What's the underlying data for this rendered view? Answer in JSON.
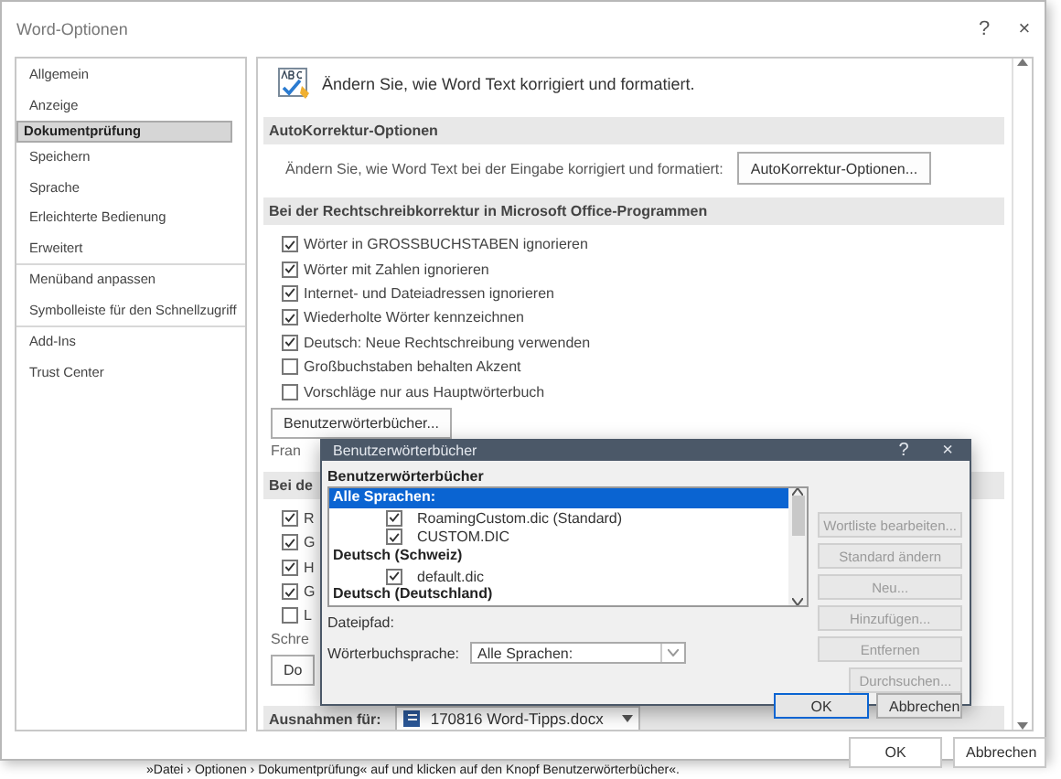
{
  "window": {
    "title": "Word-Optionen",
    "help": "?",
    "close": "×"
  },
  "sidebar": {
    "groups": [
      {
        "items": [
          {
            "label": "Allgemein",
            "selected": false
          },
          {
            "label": "Anzeige",
            "selected": false
          },
          {
            "label": "Dokumentprüfung",
            "selected": true
          },
          {
            "label": "Speichern",
            "selected": false
          },
          {
            "label": "Sprache",
            "selected": false
          },
          {
            "label": "Erleichterte Bedienung",
            "selected": false
          },
          {
            "label": "Erweitert",
            "selected": false
          }
        ]
      },
      {
        "items": [
          {
            "label": "Menüband anpassen",
            "selected": false
          },
          {
            "label": "Symbolleiste für den Schnellzugriff",
            "selected": false
          }
        ]
      },
      {
        "items": [
          {
            "label": "Add-Ins",
            "selected": false
          },
          {
            "label": "Trust Center",
            "selected": false
          }
        ]
      }
    ]
  },
  "content": {
    "intro": "Ändern Sie, wie Word Text korrigiert und formatiert.",
    "sections": [
      {
        "heading": "AutoKorrektur-Optionen",
        "items": [
          {
            "kind": "text_button",
            "text": "Ändern Sie, wie Word Text bei der Eingabe korrigiert und formatiert:",
            "button": "AutoKorrektur-Optionen..."
          }
        ]
      },
      {
        "heading": "Bei der Rechtschreibkorrektur in Microsoft Office-Programmen",
        "items": [
          {
            "kind": "checkbox",
            "label": "Wörter in GROSSBUCHSTABEN ignorieren",
            "checked": true
          },
          {
            "kind": "checkbox",
            "label": "Wörter mit Zahlen ignorieren",
            "checked": true
          },
          {
            "kind": "checkbox",
            "label": "Internet- und Dateiadressen ignorieren",
            "checked": true
          },
          {
            "kind": "checkbox",
            "label": "Wiederholte Wörter kennzeichnen",
            "checked": true
          },
          {
            "kind": "checkbox",
            "label": "Deutsch: Neue Rechtschreibung verwenden",
            "checked": true
          },
          {
            "kind": "checkbox",
            "label": "Großbuchstaben behalten Akzent",
            "checked": false
          },
          {
            "kind": "checkbox",
            "label": "Vorschläge nur aus Hauptwörterbuch",
            "checked": false
          },
          {
            "kind": "button",
            "label": "Benutzerwörterbücher..."
          },
          {
            "kind": "label",
            "text": "Fran"
          }
        ]
      },
      {
        "heading": "Bei de",
        "items": [
          {
            "kind": "checkbox",
            "label": "R",
            "checked": true
          },
          {
            "kind": "checkbox",
            "label": "G",
            "checked": true
          },
          {
            "kind": "checkbox",
            "label": "H",
            "checked": true
          },
          {
            "kind": "checkbox",
            "label": "G",
            "checked": true
          },
          {
            "kind": "checkbox",
            "label": "L",
            "checked": false
          },
          {
            "kind": "label",
            "text": "Schre"
          },
          {
            "kind": "button",
            "label": "Do"
          }
        ]
      },
      {
        "heading": "Ausnahmen für:",
        "dropdown": "170816 Word-Tipps.docx"
      }
    ]
  },
  "footer_buttons": [
    "OK",
    "Abbrechen"
  ],
  "dialog": {
    "title": "Benutzerwörterbücher",
    "help": "?",
    "close": "×",
    "list_label": "Benutzerwörterbücher",
    "list": [
      {
        "kind": "group",
        "label": "Alle Sprachen:",
        "selected": true
      },
      {
        "kind": "file",
        "label": "RoamingCustom.dic (Standard)",
        "checked": true,
        "selected": false
      },
      {
        "kind": "file",
        "label": "CUSTOM.DIC",
        "checked": true,
        "selected": false
      },
      {
        "kind": "group",
        "label": "Deutsch (Schweiz)",
        "selected": false
      },
      {
        "kind": "file",
        "label": "default.dic",
        "checked": true,
        "selected": false
      },
      {
        "kind": "group",
        "label": "Deutsch (Deutschland)",
        "selected": false
      }
    ],
    "path_label": "Dateipfad:",
    "language_label": "Wörterbuchsprache:",
    "language_value": "Alle Sprachen:",
    "side_buttons": [
      {
        "label": "Wortliste bearbeiten...",
        "disabled": true
      },
      {
        "label": "Standard ändern",
        "disabled": true
      },
      {
        "label": "Neu...",
        "disabled": true
      },
      {
        "label": "Hinzufügen...",
        "disabled": true
      },
      {
        "label": "Entfernen",
        "disabled": true
      },
      {
        "label": "Durchsuchen...",
        "disabled": true
      }
    ],
    "buttons": [
      {
        "label": "OK",
        "default": true
      },
      {
        "label": "Abbrechen",
        "default": false
      }
    ]
  },
  "caption": "»Datei › Optionen › Dokumentprüfung« auf und klicken auf den Knopf Benutzerwörterbücher«."
}
